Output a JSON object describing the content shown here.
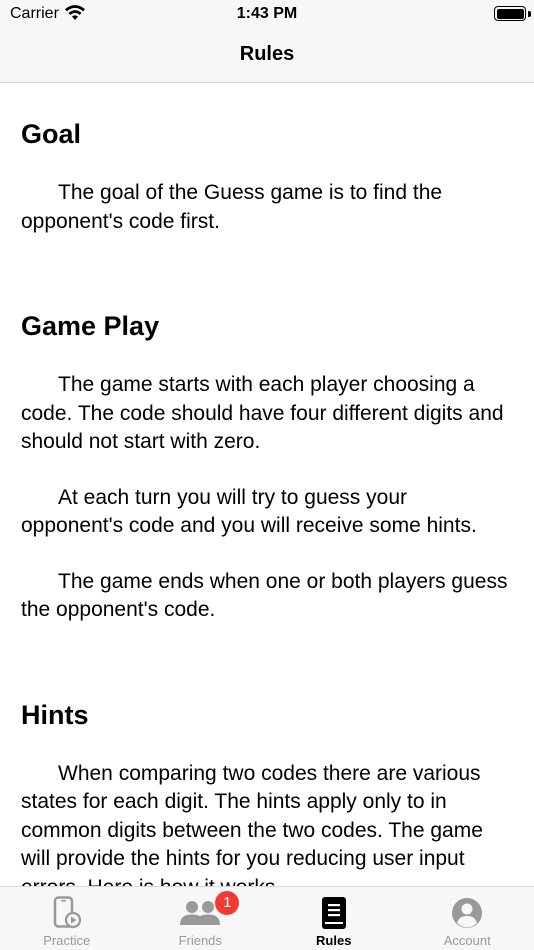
{
  "status_bar": {
    "carrier": "Carrier",
    "time": "1:43 PM",
    "wifi_icon": "wifi-icon",
    "battery_icon": "battery-icon"
  },
  "nav": {
    "title": "Rules"
  },
  "sections": [
    {
      "title": "Goal",
      "paragraphs": [
        "The goal of the Guess game is to find the opponent's code first."
      ]
    },
    {
      "title": "Game Play",
      "paragraphs": [
        "The game starts with each player choosing a code. The code should have four different digits and should not start with zero.",
        "At each turn you will try to guess your opponent's code and you will receive some hints.",
        "The game ends when one or both players guess the opponent's code."
      ]
    },
    {
      "title": "Hints",
      "paragraphs": [
        "When comparing two codes there are various states for each digit. The hints apply only to in common digits between the two codes. The game will provide the hints for you reducing user input errors. Here is how it works."
      ]
    }
  ],
  "tabs": [
    {
      "label": "Practice",
      "icon": "phone-play-icon",
      "active": false
    },
    {
      "label": "Friends",
      "icon": "people-icon",
      "active": false,
      "badge": "1"
    },
    {
      "label": "Rules",
      "icon": "book-icon",
      "active": true
    },
    {
      "label": "Account",
      "icon": "person-circle-icon",
      "active": false
    }
  ],
  "colors": {
    "bar_background": "#f7f7f7",
    "badge": "#f03a33",
    "inactive_tab": "#999999",
    "active_tab": "#000000"
  }
}
